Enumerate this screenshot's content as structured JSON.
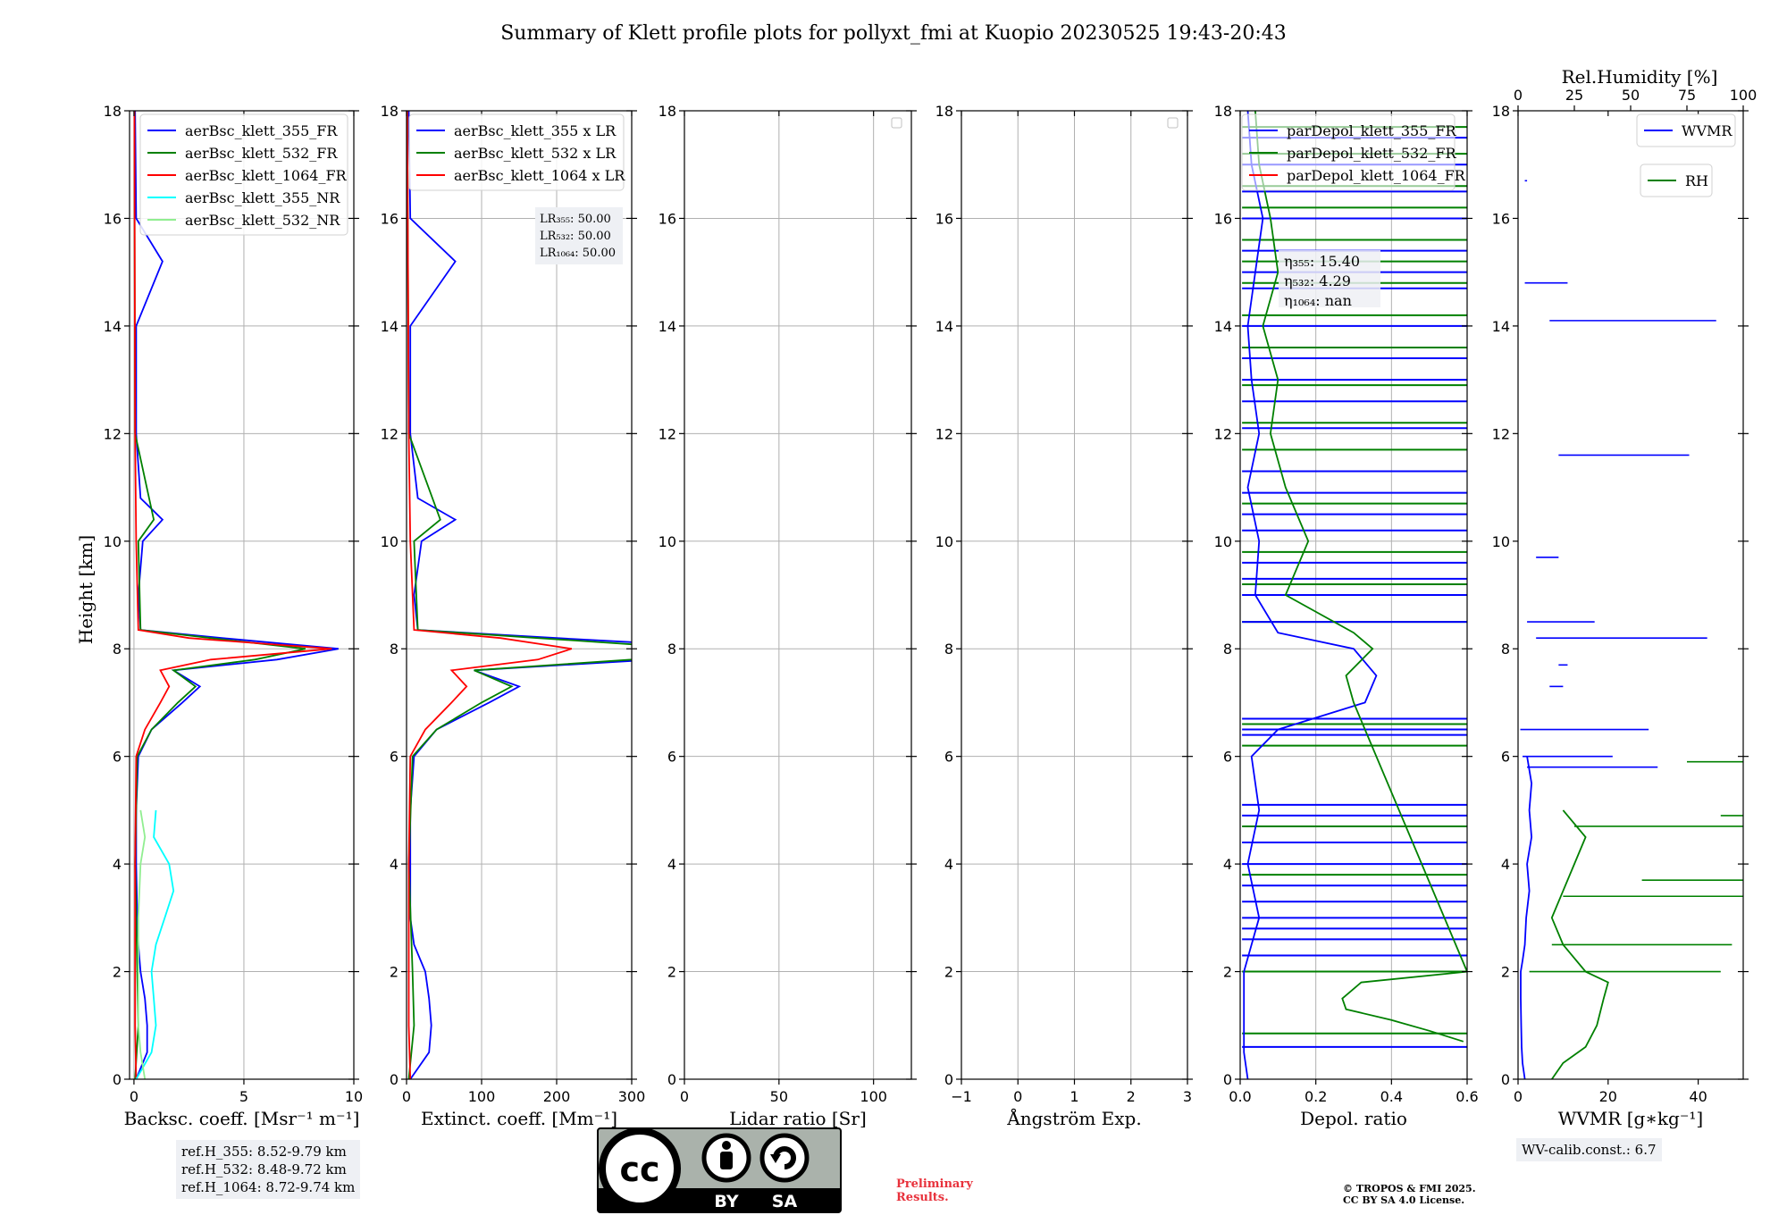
{
  "title": "Summary of Klett profile plots for pollyxt_fmi at Kuopio 20230525 19:43-20:43",
  "ylabel": "Height [km]",
  "ref_heights": [
    "ref.H_355: 8.52-9.79 km",
    "ref.H_532: 8.48-9.72 km",
    "ref.H_1064: 8.72-9.74 km"
  ],
  "wv_calib": "WV-calib.const.: 6.7",
  "preliminary": [
    "Preliminary",
    "Results."
  ],
  "copyright": [
    "© TROPOS & FMI 2025.",
    "CC BY SA 4.0 License."
  ],
  "license_badge": {
    "by": "BY",
    "sa": "SA",
    "cc": "cc"
  },
  "colors": {
    "c355": "#0000ff",
    "c532": "#008000",
    "c1064": "#ff0000",
    "c355nr": "#00ffff",
    "c532nr": "#90ee90",
    "rh": "#008000"
  },
  "chart_data": [
    {
      "id": "backscatter",
      "type": "line",
      "xlabel": "Backsc. coeff. [Msr⁻¹ m⁻¹]",
      "ylabel": "Height [km]",
      "xlim": [
        -0.2,
        10
      ],
      "ylim": [
        0,
        18
      ],
      "xticks": [
        0,
        5,
        10
      ],
      "yticks": [
        0,
        2,
        4,
        6,
        8,
        10,
        12,
        14,
        16,
        18
      ],
      "grid": true,
      "legend_position": "top-right",
      "series": [
        {
          "name": "aerBsc_klett_355_FR",
          "color": "#0000ff",
          "y": [
            0,
            0.5,
            1,
            1.5,
            2,
            2.5,
            3,
            4,
            5,
            6,
            6.5,
            7,
            7.3,
            7.6,
            7.8,
            8.0,
            8.2,
            8.35,
            9,
            10,
            10.4,
            10.8,
            12,
            14,
            15.2,
            16,
            18
          ],
          "x": [
            0.1,
            0.6,
            0.6,
            0.5,
            0.3,
            0.2,
            0.15,
            0.1,
            0.1,
            0.2,
            0.8,
            2.2,
            3.0,
            1.8,
            6.5,
            9.3,
            4.0,
            0.3,
            0.2,
            0.4,
            1.3,
            0.3,
            0.1,
            0.1,
            1.3,
            0.1,
            0.05
          ]
        },
        {
          "name": "aerBsc_klett_532_FR",
          "color": "#008000",
          "y": [
            0,
            1,
            2,
            4,
            6,
            6.5,
            7,
            7.3,
            7.6,
            7.8,
            8.0,
            8.2,
            8.35,
            10,
            10.4,
            12,
            18
          ],
          "x": [
            0.05,
            0.2,
            0.15,
            0.05,
            0.15,
            0.8,
            2.0,
            2.8,
            1.8,
            5.5,
            7.8,
            3.5,
            0.3,
            0.2,
            0.9,
            0.05,
            0.02
          ]
        },
        {
          "name": "aerBsc_klett_1064_FR",
          "color": "#ff0000",
          "y": [
            0,
            1,
            2,
            4,
            6,
            6.5,
            7,
            7.3,
            7.6,
            7.8,
            8.0,
            8.2,
            8.35,
            10,
            12,
            18
          ],
          "x": [
            0.1,
            0.05,
            0.05,
            0.05,
            0.1,
            0.5,
            1.2,
            1.6,
            1.2,
            3.5,
            9.0,
            2.5,
            0.2,
            0.1,
            0.05,
            0.02
          ]
        },
        {
          "name": "aerBsc_klett_355_NR",
          "color": "#00ffff",
          "y": [
            0,
            0.5,
            1,
            1.5,
            2,
            2.5,
            3,
            3.5,
            4,
            4.5,
            5
          ],
          "x": [
            0.1,
            0.8,
            1.0,
            0.9,
            0.8,
            1.0,
            1.4,
            1.8,
            1.6,
            0.9,
            1.0
          ]
        },
        {
          "name": "aerBsc_klett_532_NR",
          "color": "#90ee90",
          "y": [
            0,
            0.5,
            1,
            2,
            3,
            4,
            4.5,
            5
          ],
          "x": [
            0.5,
            0.3,
            0.2,
            0.2,
            0.2,
            0.3,
            0.5,
            0.3
          ]
        }
      ]
    },
    {
      "id": "extinction",
      "type": "line",
      "xlabel": "Extinct. coeff. [Mm⁻¹]",
      "xlim": [
        0,
        300
      ],
      "ylim": [
        0,
        18
      ],
      "xticks": [
        0,
        100,
        200,
        300
      ],
      "yticks": [
        0,
        2,
        4,
        6,
        8,
        10,
        12,
        14,
        16,
        18
      ],
      "grid": true,
      "legend_position": "top-right",
      "lidar_ratios": [
        "LR₃₅₅: 50.00",
        "LR₅₃₂: 50.00",
        "LR₁₀₆₄: 50.00"
      ],
      "series": [
        {
          "name": "aerBsc_klett_355 x LR",
          "color": "#0000ff",
          "y": [
            0,
            0.5,
            1,
            1.5,
            2,
            2.5,
            3,
            4,
            5,
            6,
            6.5,
            7,
            7.3,
            7.6,
            7.8,
            8.0,
            8.2,
            8.35,
            9,
            10,
            10.4,
            10.8,
            12,
            14,
            15.2,
            16,
            18
          ],
          "x": [
            5,
            30,
            33,
            30,
            25,
            10,
            5,
            5,
            5,
            10,
            40,
            110,
            150,
            90,
            330,
            460,
            200,
            15,
            10,
            20,
            65,
            15,
            5,
            5,
            65,
            5,
            3
          ]
        },
        {
          "name": "aerBsc_klett_532 x LR",
          "color": "#008000",
          "y": [
            0,
            1,
            2,
            4,
            6,
            6.5,
            7,
            7.3,
            7.6,
            7.8,
            8.0,
            8.2,
            8.35,
            10,
            10.4,
            12,
            18
          ],
          "x": [
            3,
            10,
            8,
            3,
            8,
            40,
            100,
            140,
            90,
            300,
            390,
            175,
            15,
            10,
            45,
            3,
            1
          ]
        },
        {
          "name": "aerBsc_klett_1064 x LR",
          "color": "#ff0000",
          "y": [
            0,
            1,
            2,
            4,
            6,
            6.5,
            7,
            7.3,
            7.6,
            7.8,
            8.0,
            8.2,
            8.35,
            10,
            12,
            18
          ],
          "x": [
            5,
            3,
            3,
            3,
            5,
            25,
            60,
            80,
            60,
            175,
            220,
            125,
            10,
            5,
            3,
            1
          ]
        }
      ]
    },
    {
      "id": "lidar_ratio",
      "type": "line",
      "xlabel": "Lidar ratio [Sr]",
      "xlim": [
        0,
        120
      ],
      "ylim": [
        0,
        18
      ],
      "xticks": [
        0,
        50,
        100
      ],
      "yticks": [
        0,
        2,
        4,
        6,
        8,
        10,
        12,
        14,
        16,
        18
      ],
      "grid": true,
      "legend_position": "top-right",
      "series": []
    },
    {
      "id": "angstrom",
      "type": "line",
      "xlabel": "Ångström Exp.",
      "xlim": [
        -1,
        3
      ],
      "ylim": [
        0,
        18
      ],
      "xticks": [
        -1,
        0,
        1,
        2,
        3
      ],
      "yticks": [
        0,
        2,
        4,
        6,
        8,
        10,
        12,
        14,
        16,
        18
      ],
      "grid": true,
      "legend_position": "top-right",
      "series": []
    },
    {
      "id": "depol",
      "type": "line",
      "xlabel": "Depol. ratio",
      "xlim": [
        0,
        0.6
      ],
      "ylim": [
        0,
        18
      ],
      "xticks": [
        0.0,
        0.2,
        0.4,
        0.6
      ],
      "xtick_labels": [
        "0.0",
        "0.2",
        "0.4",
        "0.6"
      ],
      "yticks": [
        0,
        2,
        4,
        6,
        8,
        10,
        12,
        14,
        16,
        18
      ],
      "grid": true,
      "legend_position": "top-left",
      "eta": [
        "η₃₅₅: 15.40",
        "η₅₃₂: 4.29",
        "η₁₀₆₄: nan"
      ],
      "series": [
        {
          "name": "parDepol_klett_355_FR",
          "color": "#0000ff",
          "y": [
            0,
            0.5,
            1,
            1.5,
            2,
            3,
            4,
            5,
            6,
            6.5,
            7,
            7.5,
            8,
            8.3,
            9,
            10,
            11,
            12,
            13,
            14,
            15,
            16,
            17,
            18
          ],
          "x": [
            0.02,
            0.01,
            0.01,
            0.01,
            0.01,
            0.05,
            0.02,
            0.05,
            0.03,
            0.1,
            0.33,
            0.36,
            0.3,
            0.1,
            0.04,
            0.05,
            0.02,
            0.05,
            0.03,
            0.02,
            0.04,
            0.06,
            0.03,
            0.02
          ]
        },
        {
          "name": "parDepol_klett_532_FR",
          "color": "#008000",
          "y": [
            0.7,
            0.9,
            1.1,
            1.3,
            1.5,
            1.8,
            2.0,
            6.5,
            7.0,
            7.5,
            8.0,
            8.3,
            9,
            10,
            11,
            12,
            13,
            14,
            15,
            16,
            17,
            18
          ],
          "x": [
            0.59,
            0.5,
            0.4,
            0.28,
            0.27,
            0.32,
            0.6,
            0.33,
            0.3,
            0.28,
            0.35,
            0.3,
            0.12,
            0.18,
            0.12,
            0.08,
            0.1,
            0.06,
            0.1,
            0.08,
            0.05,
            0.04
          ]
        },
        {
          "name": "parDepol_klett_1064_FR",
          "color": "#ff0000",
          "y": [],
          "x": []
        }
      ],
      "spikes_355_km": [
        0.6,
        2.3,
        2.6,
        2.8,
        3.0,
        3.3,
        3.6,
        4.0,
        4.4,
        4.9,
        5.1,
        6.4,
        6.5,
        6.7,
        8.5,
        9.0,
        9.3,
        9.6,
        10.2,
        10.5,
        10.9,
        11.3,
        12.1,
        12.6,
        13.0,
        13.4,
        14.0,
        14.7,
        15.0,
        15.4,
        16.0,
        16.5,
        17.0,
        17.5
      ],
      "spikes_532_km": [
        0.85,
        2.0,
        3.8,
        4.7,
        6.2,
        6.6,
        8.5,
        9.2,
        9.8,
        10.7,
        11.7,
        12.2,
        12.9,
        13.6,
        14.2,
        14.8,
        15.2,
        15.6,
        16.2,
        16.6,
        17.2,
        17.7
      ]
    },
    {
      "id": "wvmr",
      "type": "line",
      "xlabel": "WVMR [g∗kg⁻¹]",
      "xlim": [
        0,
        50
      ],
      "ylim": [
        0,
        18
      ],
      "xticks": [
        0,
        20,
        40
      ],
      "yticks": [
        0,
        2,
        4,
        6,
        8,
        10,
        12,
        14,
        16,
        18
      ],
      "grid": false,
      "legend_position": "top-right",
      "top_axis": {
        "label": "Rel.Humidity [%]",
        "xlim": [
          0,
          100
        ],
        "ticks": [
          0,
          25,
          50,
          75,
          100
        ]
      },
      "series": [
        {
          "name": "WVMR",
          "color": "#0000ff",
          "y": [
            0,
            0.3,
            0.6,
            1.0,
            1.5,
            2.0,
            2.2,
            2.5,
            3.0,
            3.5,
            4.0,
            4.5,
            5.0,
            5.5,
            6.0
          ],
          "x": [
            1.5,
            1.0,
            0.8,
            0.7,
            0.6,
            0.6,
            1.0,
            1.5,
            1.8,
            2.5,
            2.0,
            3.0,
            2.5,
            3.0,
            2.0
          ]
        },
        {
          "name": "RH",
          "color": "#008000",
          "axis": "top",
          "y": [
            0,
            0.3,
            0.6,
            1.0,
            1.5,
            1.8,
            2.0,
            2.5,
            3.0,
            3.5,
            4.0,
            4.5,
            5.0
          ],
          "x": [
            15,
            20,
            30,
            35,
            38,
            40,
            30,
            20,
            15,
            20,
            25,
            30,
            20
          ]
        }
      ],
      "wvmr_segments": [
        [
          16.7,
          1.5,
          2.0
        ],
        [
          14.8,
          1.5,
          11.0
        ],
        [
          14.1,
          7.0,
          44.0
        ],
        [
          11.6,
          9.0,
          38.0
        ],
        [
          9.7,
          4.0,
          9.0
        ],
        [
          8.5,
          2.0,
          17.0
        ],
        [
          8.2,
          4.0,
          42.0
        ],
        [
          7.7,
          9.0,
          11.0
        ],
        [
          7.3,
          7.0,
          10.0
        ],
        [
          6.5,
          0.5,
          29.0
        ],
        [
          6.0,
          1.0,
          21.0
        ],
        [
          5.8,
          2.0,
          31.0
        ]
      ],
      "rh_segments": [
        [
          5.9,
          75,
          100
        ],
        [
          4.9,
          90,
          100
        ],
        [
          4.7,
          25,
          100
        ],
        [
          3.7,
          55,
          100
        ],
        [
          3.4,
          20,
          100
        ],
        [
          2.5,
          15,
          95
        ],
        [
          2.0,
          5,
          90
        ]
      ]
    }
  ]
}
